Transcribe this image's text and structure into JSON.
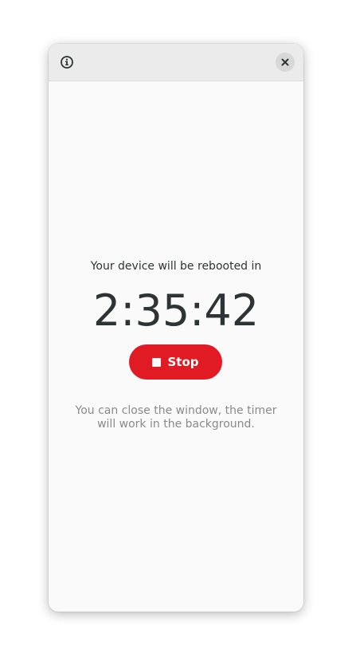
{
  "window": {
    "header": {
      "info_icon": "info-circle-icon",
      "close_icon": "close-icon"
    },
    "main": {
      "subtitle": "Your device will be rebooted in",
      "timer": "2:35:42",
      "stop_label": "Stop",
      "stop_icon": "stop-square-icon",
      "hint": "You can close the window, the timer will work in the background."
    }
  },
  "colors": {
    "accent": "#e01b24",
    "text": "#2e3436",
    "muted": "#8a8a8a"
  }
}
